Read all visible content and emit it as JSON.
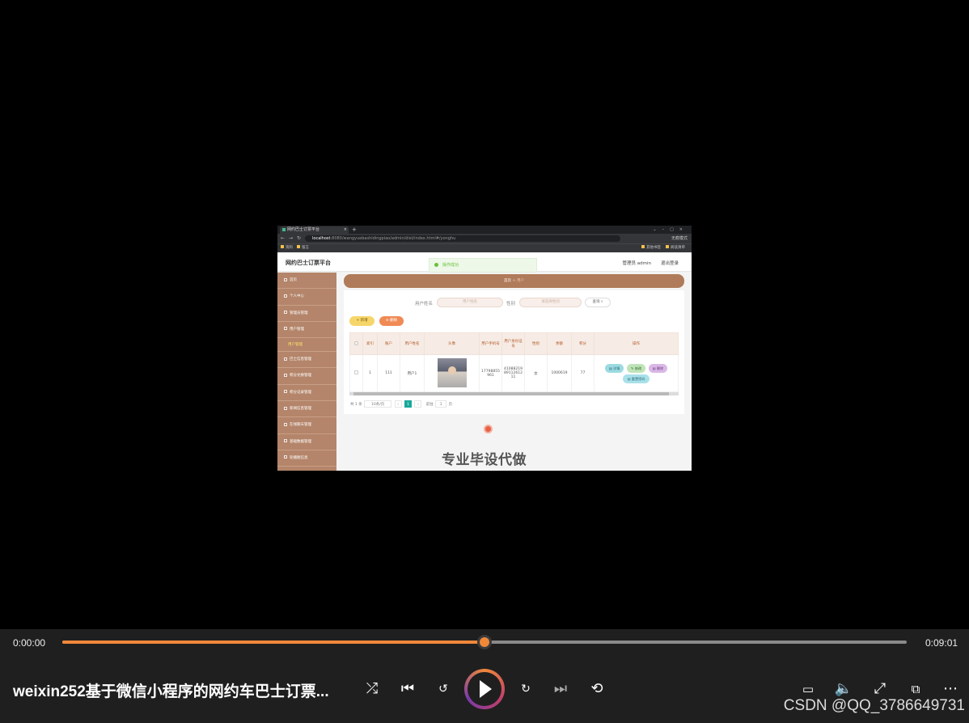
{
  "browser": {
    "tab_title": "网约巴士订票平台",
    "url_host": "localhost",
    "url_rest": ":8080/wangyuebashidingpiao/admin/dist/index.html#/yonghu",
    "bookmarks": [
      "资料",
      "留言"
    ],
    "bookmark_right": [
      "其他书签",
      "阅读清单"
    ],
    "profile_label": "无痕模式"
  },
  "app": {
    "title": "网约巴士订票平台",
    "user": "管理员 admin",
    "logout": "退出登录",
    "toast": "操作成功",
    "breadcrumb_home": "首页",
    "breadcrumb_current": "用户"
  },
  "sidebar": {
    "items": [
      "首页",
      "个人中心",
      "管理员管理",
      "用户管理",
      "巴士信息管理",
      "积分兑换管理",
      "积分记录管理",
      "新闻信息管理",
      "在线聊天管理",
      "基础数据管理",
      "轮播图信息"
    ],
    "sub_item": "用户管理"
  },
  "search": {
    "name_label": "用户姓名",
    "name_placeholder": "用户姓名",
    "gender_label": "性别",
    "gender_placeholder": "请选择性别",
    "query_button": "查询"
  },
  "actions": {
    "add": "新增",
    "delete": "删除"
  },
  "table": {
    "headers": [
      "索引",
      "账户",
      "用户姓名",
      "头像",
      "用户手机号",
      "用户身份证号",
      "性别",
      "余额",
      "积分",
      "操作"
    ],
    "row": {
      "index": "1",
      "account": "111",
      "name": "用户1",
      "phone": "17798855961",
      "idcard": "410882198911261211",
      "gender": "女",
      "balance": "1000619",
      "points": "77"
    },
    "ops": {
      "detail": "详情",
      "edit": "修改",
      "delete": "删除",
      "reset": "重置密码"
    }
  },
  "pager": {
    "total": "共 1 条",
    "page_size": "10条/页",
    "current": "1",
    "goto_label": "前往",
    "goto_value": "1",
    "page_suffix": "页"
  },
  "overlay_text": "专业毕设代做",
  "player": {
    "elapsed": "0:00:00",
    "duration": "0:09:01",
    "progress": 0.5,
    "title": "weixin252基于微信小程序的网约车巴士订票...",
    "credit": "CSDN @QQ_3786649731",
    "accent": "#f0883a",
    "icons": [
      "shuffle-icon",
      "previous-icon",
      "rewind-10-icon",
      "play-icon",
      "forward-30-icon",
      "next-icon",
      "repeat-off-icon",
      "subtitles-icon",
      "volume-icon",
      "fullscreen-icon",
      "mini-player-icon",
      "more-icon"
    ]
  }
}
